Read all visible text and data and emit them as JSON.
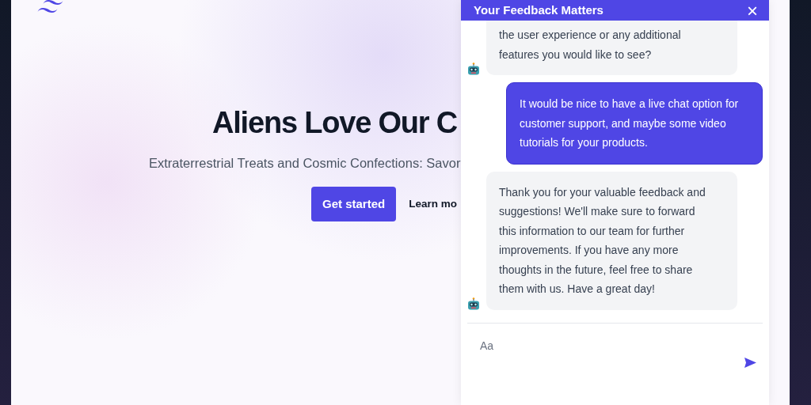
{
  "hero": {
    "heading": "Aliens Love Our C",
    "subtitle": "Extraterrestrial Treats and Cosmic Confections: Savor",
    "primary_button": "Get started",
    "secondary_link": "Learn mo"
  },
  "chat": {
    "title": "Your Feedback Matters",
    "close": "×",
    "messages": [
      {
        "kind": "bot",
        "lines": [
          "the user experience or any additional",
          "features you would like to see?"
        ]
      },
      {
        "kind": "user",
        "lines": [
          "It would be nice to have a live chat option for",
          "customer support, and maybe some video",
          "tutorials for your products."
        ]
      },
      {
        "kind": "bot",
        "lines": [
          "Thank you for your valuable feedback and",
          "suggestions! We'll make sure to forward",
          "this information to our team for further",
          "improvements. If you have any more",
          "thoughts in the future, feel free to share",
          "them with us. Have a great day!"
        ]
      }
    ],
    "input": {
      "placeholder": "Aa"
    }
  }
}
